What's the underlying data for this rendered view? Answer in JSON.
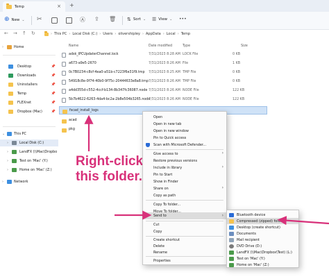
{
  "window": {
    "tab_title": "Temp"
  },
  "toolbar": {
    "new_label": "New",
    "sort_label": "Sort",
    "view_label": "View",
    "more_label": "•••"
  },
  "address": {
    "crumbs": [
      "This PC",
      "Local Disk (C:)",
      "Users",
      "olivershipley",
      "AppData",
      "Local",
      "Temp"
    ]
  },
  "sidebar": {
    "items": [
      {
        "label": "Home",
        "icon": "home-icon",
        "pinned": false
      },
      {
        "label": "Desktop",
        "icon": "desktop-icon",
        "pinned": true
      },
      {
        "label": "Downloads",
        "icon": "downloads-icon",
        "pinned": true
      },
      {
        "label": "Uninstallers",
        "icon": "folder-icon",
        "pinned": true
      },
      {
        "label": "Temp",
        "icon": "folder-icon",
        "pinned": true
      },
      {
        "label": "FLEXnet",
        "icon": "folder-icon",
        "pinned": true
      },
      {
        "label": "Dropbox (Mac)",
        "icon": "folder-icon",
        "pinned": true
      },
      {
        "label": "This PC",
        "icon": "pc-icon",
        "pinned": false
      },
      {
        "label": "Local Disk (C:)",
        "icon": "drive-icon",
        "pinned": false
      },
      {
        "label": "LandFX (\\\\Mac\\Dropbo",
        "icon": "network-drive-icon",
        "pinned": false
      },
      {
        "label": "Test on 'Mac' (Y:)",
        "icon": "network-drive-icon",
        "pinned": false
      },
      {
        "label": "Home on 'Mac' (Z:)",
        "icon": "network-drive-icon",
        "pinned": false
      },
      {
        "label": "Network",
        "icon": "network-icon",
        "pinned": false
      }
    ]
  },
  "list": {
    "headers": {
      "name": "Name",
      "date": "Date modified",
      "type": "Type",
      "size": "Size"
    },
    "rows": [
      {
        "name": "adsk_IPCUpdaterChannel.lock",
        "date": "7/31/2023 8:28 AM",
        "type": "LOCK File",
        "size": "0 KB",
        "kind": "file"
      },
      {
        "name": "a673-a9e5-2670",
        "date": "7/31/2023 8:26 AM",
        "type": "File",
        "size": "1 KB",
        "kind": "file"
      },
      {
        "name": "0c7B0234-c8cf-4ea0-a51b-c7223f6e31f9.tmp",
        "date": "7/31/2023 8:25 AM",
        "type": "TMP File",
        "size": "0 KB",
        "kind": "file"
      },
      {
        "name": "54918c8e-0f74-40b0-9f75c-20444633e8a8.tmp",
        "date": "7/31/2023 8:26 AM",
        "type": "TMP File",
        "size": "0 KB",
        "kind": "file"
      },
      {
        "name": "a4dd355d-c552-4ccf-b134-8b347fc36087.node",
        "date": "7/31/2023 8:26 AM",
        "type": "NODE File",
        "size": "122 KB",
        "kind": "file"
      },
      {
        "name": "5b7b4622-6263-4da4-bc2a-2b8e504b3265.node",
        "date": "7/31/2023 8:26 AM",
        "type": "NODE File",
        "size": "122 KB",
        "kind": "file"
      },
      {
        "name": "fscad_install_logs",
        "date": "",
        "type": "",
        "size": "",
        "kind": "folder",
        "selected": true
      },
      {
        "name": "acad",
        "date": "",
        "type": "",
        "size": "",
        "kind": "folder"
      },
      {
        "name": "pkg",
        "date": "",
        "type": "",
        "size": "",
        "kind": "folder"
      }
    ]
  },
  "context_menu": {
    "items": [
      {
        "label": "Open",
        "submenu": false
      },
      {
        "label": "Open in new tab",
        "submenu": false
      },
      {
        "label": "Open in new window",
        "submenu": false
      },
      {
        "label": "Pin to Quick access",
        "submenu": false
      },
      {
        "label": "Scan with Microsoft Defender...",
        "submenu": false,
        "icon": "defender-icon"
      },
      {
        "separator": true
      },
      {
        "label": "Give access to",
        "submenu": true
      },
      {
        "label": "Restore previous versions",
        "submenu": false
      },
      {
        "label": "Include in library",
        "submenu": true
      },
      {
        "label": "Pin to Start",
        "submenu": false
      },
      {
        "label": "Show in Finder",
        "submenu": false
      },
      {
        "label": "Share on",
        "submenu": true
      },
      {
        "label": "Copy as path",
        "submenu": false
      },
      {
        "separator": true
      },
      {
        "label": "Copy To folder...",
        "submenu": false
      },
      {
        "label": "Move To folder...",
        "submenu": false
      },
      {
        "label": "Send to",
        "submenu": true,
        "hover": true
      },
      {
        "separator": true
      },
      {
        "label": "Cut",
        "submenu": false
      },
      {
        "label": "Copy",
        "submenu": false
      },
      {
        "separator": true
      },
      {
        "label": "Create shortcut",
        "submenu": false
      },
      {
        "label": "Delete",
        "submenu": false
      },
      {
        "label": "Rename",
        "submenu": false
      },
      {
        "separator": true
      },
      {
        "label": "Properties",
        "submenu": false
      }
    ]
  },
  "send_to_menu": {
    "items": [
      {
        "label": "Bluetooth device",
        "icon": "bluetooth-icon",
        "color": "#2a6bd6"
      },
      {
        "label": "Compressed (zipped) folder",
        "icon": "zip-folder-icon",
        "color": "#f5c34d",
        "hover": true
      },
      {
        "label": "Desktop (create shortcut)",
        "icon": "desktop-icon",
        "color": "#3d8fe0"
      },
      {
        "label": "Documents",
        "icon": "documents-icon",
        "color": "#6c8ebf"
      },
      {
        "label": "Mail recipient",
        "icon": "mail-icon",
        "color": "#8fa3b8"
      },
      {
        "label": "DVD Drive (D:)",
        "icon": "dvd-icon",
        "color": "#7a7a7a"
      },
      {
        "label": "LandFX (\\\\Mac\\Dropbox\\Test) (L:)",
        "icon": "network-drive-icon",
        "color": "#4a9a4a"
      },
      {
        "label": "Test on 'Mac' (Y:)",
        "icon": "network-drive-icon",
        "color": "#4a9a4a"
      },
      {
        "label": "Home on 'Mac' (Z:)",
        "icon": "network-drive-icon",
        "color": "#4a9a4a"
      }
    ]
  },
  "annotation": {
    "line1": "Right-click",
    "line2": "this folder.",
    "color": "#d8317a"
  }
}
